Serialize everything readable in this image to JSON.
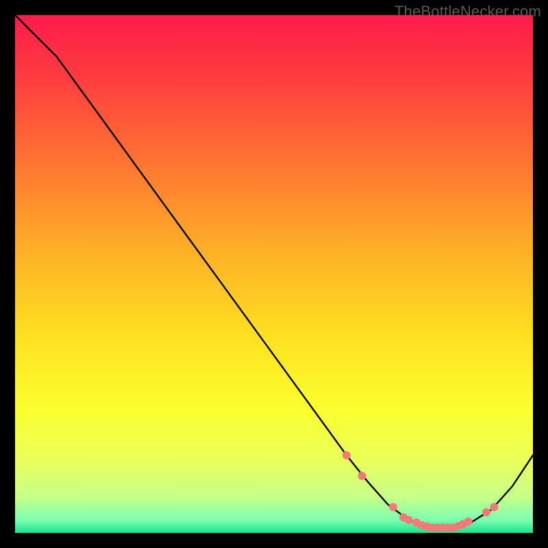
{
  "watermark": "TheBottleNecker.com",
  "chart_data": {
    "type": "line",
    "title": "",
    "xlabel": "",
    "ylabel": "",
    "xlim": [
      0,
      100
    ],
    "ylim": [
      0,
      100
    ],
    "background_gradient": [
      {
        "pos": 0.0,
        "color": "#ff1b4b"
      },
      {
        "pos": 0.12,
        "color": "#ff3c3f"
      },
      {
        "pos": 0.3,
        "color": "#ff7a31"
      },
      {
        "pos": 0.46,
        "color": "#ffb127"
      },
      {
        "pos": 0.62,
        "color": "#ffe020"
      },
      {
        "pos": 0.76,
        "color": "#fbff2d"
      },
      {
        "pos": 0.86,
        "color": "#e9ff5a"
      },
      {
        "pos": 0.93,
        "color": "#c7ff8a"
      },
      {
        "pos": 0.975,
        "color": "#7cffb0"
      },
      {
        "pos": 1.0,
        "color": "#19e38c"
      }
    ],
    "series": [
      {
        "name": "bottleneck-curve",
        "color": "#000000",
        "x": [
          0,
          8,
          16,
          24,
          32,
          40,
          48,
          56,
          60,
          64,
          68,
          72,
          76,
          80,
          84,
          88,
          92,
          96,
          100
        ],
        "y": [
          100,
          92,
          81,
          70,
          59,
          48,
          37,
          26,
          20.5,
          15,
          10,
          5.5,
          2.5,
          1,
          1,
          2,
          4.5,
          9,
          15
        ]
      }
    ],
    "markers": {
      "name": "highlight-dots",
      "color": "#f47a7a",
      "radius_px": 6,
      "points": [
        {
          "x": 64,
          "y": 15
        },
        {
          "x": 67,
          "y": 11
        },
        {
          "x": 73,
          "y": 5
        },
        {
          "x": 75,
          "y": 3
        },
        {
          "x": 76,
          "y": 2.5
        },
        {
          "x": 77.5,
          "y": 2
        },
        {
          "x": 78.5,
          "y": 1.5
        },
        {
          "x": 79.5,
          "y": 1.2
        },
        {
          "x": 80.5,
          "y": 1
        },
        {
          "x": 81.5,
          "y": 1
        },
        {
          "x": 82.5,
          "y": 1
        },
        {
          "x": 83.5,
          "y": 1
        },
        {
          "x": 84.5,
          "y": 1
        },
        {
          "x": 85.5,
          "y": 1.3
        },
        {
          "x": 86.5,
          "y": 1.7
        },
        {
          "x": 87.5,
          "y": 2.2
        },
        {
          "x": 91,
          "y": 4
        },
        {
          "x": 92.5,
          "y": 5
        }
      ]
    }
  }
}
